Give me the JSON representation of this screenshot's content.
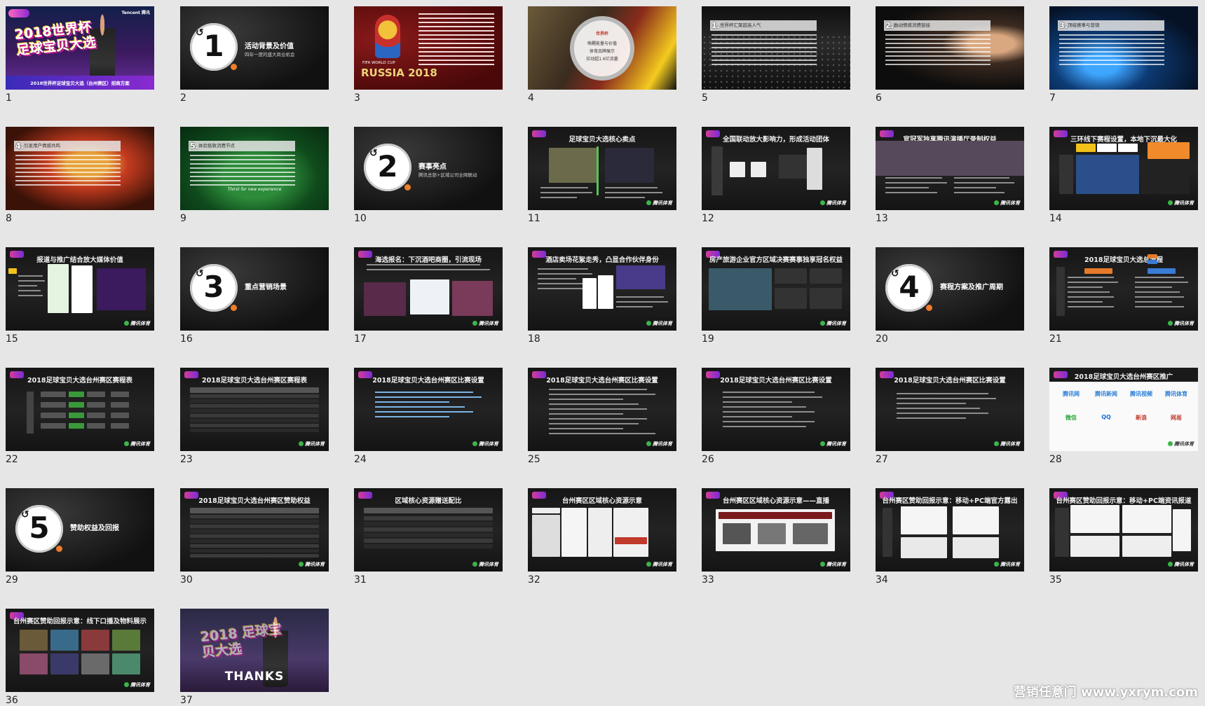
{
  "colors": {
    "background": "#e6e6e6",
    "number_text": "#222222",
    "section_dot": "#f07d2a",
    "slide_dark": "#1a1a1a",
    "cover_band": "#6a2f9e"
  },
  "slides": [
    {
      "number": "1",
      "kind": "cover",
      "title": "2018世界杯 足球宝贝大选",
      "subtitle": "2018世界杯足球宝贝大选（台州赛区）招商方案",
      "brand": "Tencent 腾讯"
    },
    {
      "number": "2",
      "kind": "section",
      "digit": "1",
      "title": "活动背景及价值",
      "subtitle": "四年一度的盛大商业机会"
    },
    {
      "number": "3",
      "kind": "worldcup",
      "title": "FIFA WORLD CUP",
      "subtitle": "RUSSIA 2018"
    },
    {
      "number": "4",
      "kind": "circle-stat",
      "title": "世界杯",
      "lines": [
        "唤醒能量与价值",
        "体育品牌展示",
        "拉动超1.6亿流量"
      ]
    },
    {
      "number": "5",
      "kind": "strip",
      "bg": "crowd",
      "digit": "1.",
      "title": "世界杯汇聚超高人气"
    },
    {
      "number": "6",
      "kind": "strip",
      "bg": "hand",
      "digit": "2.",
      "title": "触动情感消费链接"
    },
    {
      "number": "7",
      "kind": "strip",
      "bg": "tech",
      "digit": "3.",
      "title": "顶级赛事与营销"
    },
    {
      "number": "8",
      "kind": "strip",
      "bg": "face",
      "digit": "4.",
      "title": "引发用户情感共鸣"
    },
    {
      "number": "9",
      "kind": "strip",
      "bg": "green",
      "digit": "5.",
      "title": "体验极致消费节点",
      "tag": "Thirst for new experience"
    },
    {
      "number": "10",
      "kind": "section",
      "digit": "2",
      "title": "赛事亮点",
      "subtitle": "腾讯总部+区域公司全网联动"
    },
    {
      "number": "11",
      "kind": "content",
      "title": "足球宝贝大选核心卖点"
    },
    {
      "number": "12",
      "kind": "content",
      "title": "全国联动放大影响力，形成活动团体"
    },
    {
      "number": "13",
      "kind": "content",
      "title": "官冠军独享腾讯演播厅录制权益"
    },
    {
      "number": "14",
      "kind": "content",
      "title": "三环线下赛程设置，本地下沉最大化"
    },
    {
      "number": "15",
      "kind": "content",
      "title": "报道与推广结合放大媒体价值"
    },
    {
      "number": "16",
      "kind": "section",
      "digit": "3",
      "title": "重点营销场景",
      "subtitle": ""
    },
    {
      "number": "17",
      "kind": "content",
      "title": "海选报名：下沉酒吧商圈，引流现场"
    },
    {
      "number": "18",
      "kind": "content",
      "title": "酒店卖场花絮走秀，凸显合作伙伴身份"
    },
    {
      "number": "19",
      "kind": "content",
      "title": "房产旅游企业官方区域决赛赛事独享冠名权益"
    },
    {
      "number": "20",
      "kind": "section",
      "digit": "4",
      "title": "赛程方案及推广周期",
      "subtitle": ""
    },
    {
      "number": "21",
      "kind": "content",
      "title": "2018足球宝贝大选总流程"
    },
    {
      "number": "22",
      "kind": "content",
      "title": "2018足球宝贝大选台州赛区赛程表"
    },
    {
      "number": "23",
      "kind": "content",
      "title": "2018足球宝贝大选台州赛区赛程表"
    },
    {
      "number": "24",
      "kind": "content",
      "title": "2018足球宝贝大选台州赛区比赛设置"
    },
    {
      "number": "25",
      "kind": "content",
      "title": "2018足球宝贝大选台州赛区比赛设置"
    },
    {
      "number": "26",
      "kind": "content",
      "title": "2018足球宝贝大选台州赛区比赛设置"
    },
    {
      "number": "27",
      "kind": "content",
      "title": "2018足球宝贝大选台州赛区比赛设置"
    },
    {
      "number": "28",
      "kind": "logos",
      "title": "2018足球宝贝大选台州赛区推广",
      "logos": [
        "腾讯网",
        "腾讯新闻",
        "腾讯视频",
        "腾讯体育",
        "微信",
        "QQ",
        "新浪",
        "网易"
      ]
    },
    {
      "number": "29",
      "kind": "section",
      "digit": "5",
      "title": "赞助权益及回报",
      "subtitle": ""
    },
    {
      "number": "30",
      "kind": "content",
      "title": "2018足球宝贝大选台州赛区赞助权益"
    },
    {
      "number": "31",
      "kind": "content",
      "title": "区域核心资源赠送配比"
    },
    {
      "number": "32",
      "kind": "content",
      "title": "台州赛区区域核心资源示意"
    },
    {
      "number": "33",
      "kind": "content",
      "title": "台州赛区区域核心资源示意——直播"
    },
    {
      "number": "34",
      "kind": "content",
      "title": "台州赛区赞助回报示意：移动+PC端官方露出"
    },
    {
      "number": "35",
      "kind": "content",
      "title": "台州赛区赞助回报示意：移动+PC端资讯报道"
    },
    {
      "number": "36",
      "kind": "content",
      "title": "台州赛区赞助回报示意：线下口播及物料展示"
    },
    {
      "number": "37",
      "kind": "thanks",
      "title": "2018 足球宝贝大选",
      "thanks": "THANKS"
    }
  ],
  "footer_logo": "腾讯体育",
  "watermark": "营销任意门 www.yxrym.com"
}
